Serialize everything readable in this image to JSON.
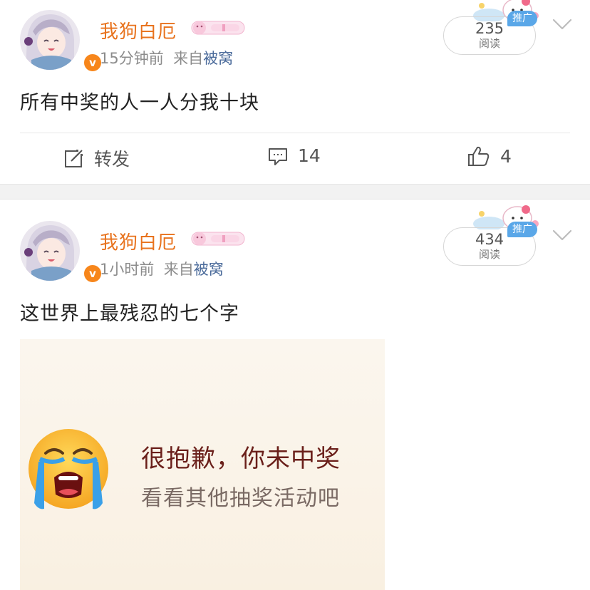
{
  "posts": [
    {
      "username": "我狗白厄",
      "time": "15分钟前",
      "source_prefix": "来自",
      "source": "被窝",
      "read_count": "235",
      "read_label": "阅读",
      "promo_label": "推广",
      "text": "所有中奖的人一人分我十块",
      "actions": {
        "repost_label": "转发",
        "comment_count": "14",
        "like_count": "4"
      }
    },
    {
      "username": "我狗白厄",
      "time": "1小时前",
      "source_prefix": "来自",
      "source": "被窝",
      "read_count": "434",
      "read_label": "阅读",
      "promo_label": "推广",
      "text": "这世界上最残忍的七个字",
      "image_text": {
        "line1": "很抱歉，你未中奖",
        "line2": "看看其他抽奖活动吧"
      }
    }
  ],
  "verified_badge": "v",
  "colors": {
    "username": "#e8731e",
    "source_link": "#4a6a9a",
    "verified": "#f7861b",
    "promo": "#5aa7e8"
  },
  "icons": [
    "avatar",
    "verified-icon",
    "vip-badge-icon",
    "hello-kitty-sticker-icon",
    "chevron-down-icon",
    "repost-icon",
    "comment-icon",
    "like-icon",
    "crying-emoji-icon"
  ]
}
